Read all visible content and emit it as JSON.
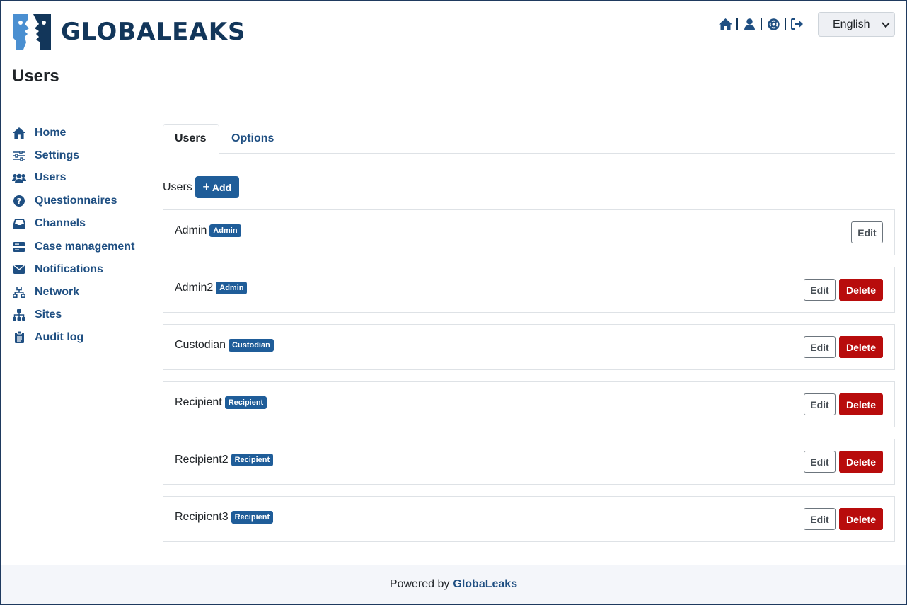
{
  "header": {
    "logo_text": "GLOBALEAKS",
    "language": "English",
    "icons": [
      "home-icon",
      "user-icon",
      "support-icon",
      "logout-icon"
    ]
  },
  "page_title": "Users",
  "sidebar": {
    "items": [
      {
        "label": "Home",
        "icon": "home-icon"
      },
      {
        "label": "Settings",
        "icon": "sliders-icon"
      },
      {
        "label": "Users",
        "icon": "users-icon"
      },
      {
        "label": "Questionnaires",
        "icon": "question-icon"
      },
      {
        "label": "Channels",
        "icon": "inbox-icon"
      },
      {
        "label": "Case management",
        "icon": "server-icon"
      },
      {
        "label": "Notifications",
        "icon": "envelope-icon"
      },
      {
        "label": "Network",
        "icon": "network-icon"
      },
      {
        "label": "Sites",
        "icon": "sitemap-icon"
      },
      {
        "label": "Audit log",
        "icon": "clipboard-icon"
      }
    ],
    "active": "Users"
  },
  "tabs": [
    {
      "label": "Users",
      "active": true
    },
    {
      "label": "Options",
      "active": false
    }
  ],
  "users_section": {
    "label": "Users",
    "add_label": "Add"
  },
  "users": [
    {
      "name": "Admin",
      "role": "Admin",
      "edit": "Edit",
      "delete": null
    },
    {
      "name": "Admin2",
      "role": "Admin",
      "edit": "Edit",
      "delete": "Delete"
    },
    {
      "name": "Custodian",
      "role": "Custodian",
      "edit": "Edit",
      "delete": "Delete"
    },
    {
      "name": "Recipient",
      "role": "Recipient",
      "edit": "Edit",
      "delete": "Delete"
    },
    {
      "name": "Recipient2",
      "role": "Recipient",
      "edit": "Edit",
      "delete": "Delete"
    },
    {
      "name": "Recipient3",
      "role": "Recipient",
      "edit": "Edit",
      "delete": "Delete"
    }
  ],
  "footer": {
    "prefix": "Powered by",
    "brand": "GlobaLeaks"
  },
  "colors": {
    "primary": "#1f5d99",
    "nav": "#1f4f82",
    "danger": "#b80c0c",
    "logo": "#12365a"
  }
}
